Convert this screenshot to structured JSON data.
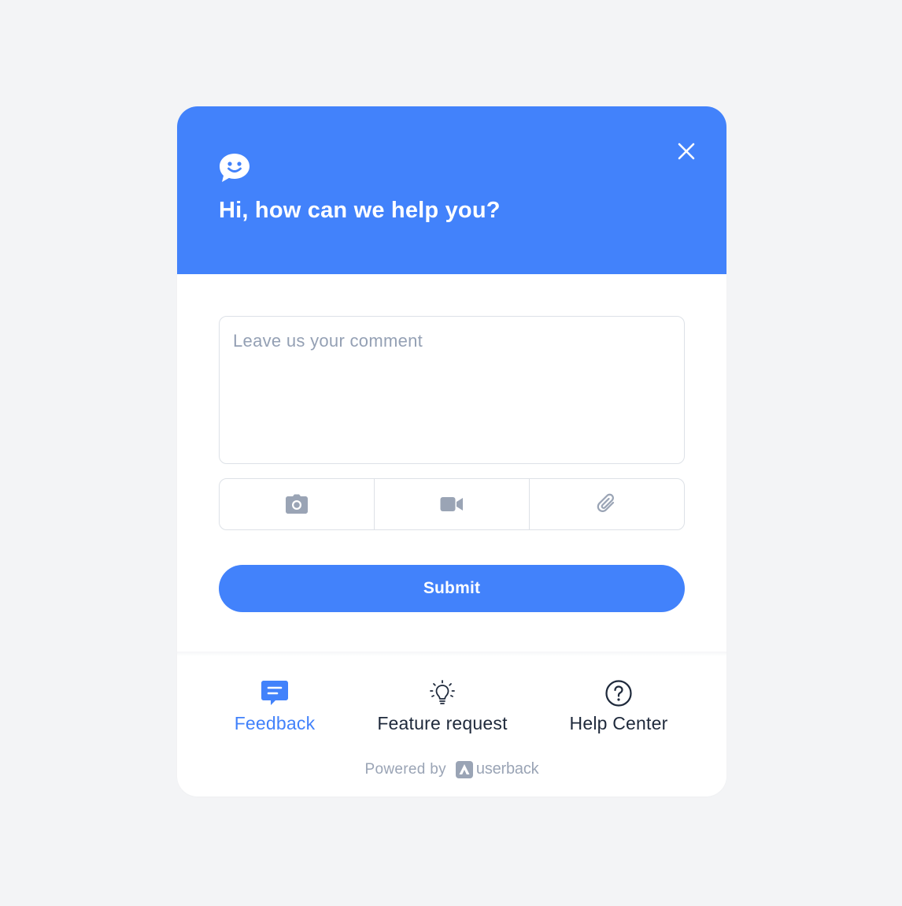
{
  "header": {
    "title": "Hi, how can we help you?",
    "icon": "smiley-chat-icon",
    "close_icon": "close-icon"
  },
  "comment": {
    "placeholder": "Leave us your comment",
    "value": ""
  },
  "attachments": [
    {
      "icon": "camera-icon"
    },
    {
      "icon": "video-camera-icon"
    },
    {
      "icon": "paperclip-icon"
    }
  ],
  "submit_label": "Submit",
  "nav": {
    "feedback_label": "Feedback",
    "feature_label": "Feature request",
    "help_label": "Help Center",
    "active": "Feedback"
  },
  "footer": {
    "powered_by": "Powered by",
    "brand": "userback"
  },
  "colors": {
    "accent": "#4282fb",
    "background": "#f3f4f6",
    "muted_icon": "#9aa4b5",
    "text_dark": "#1e293b"
  }
}
